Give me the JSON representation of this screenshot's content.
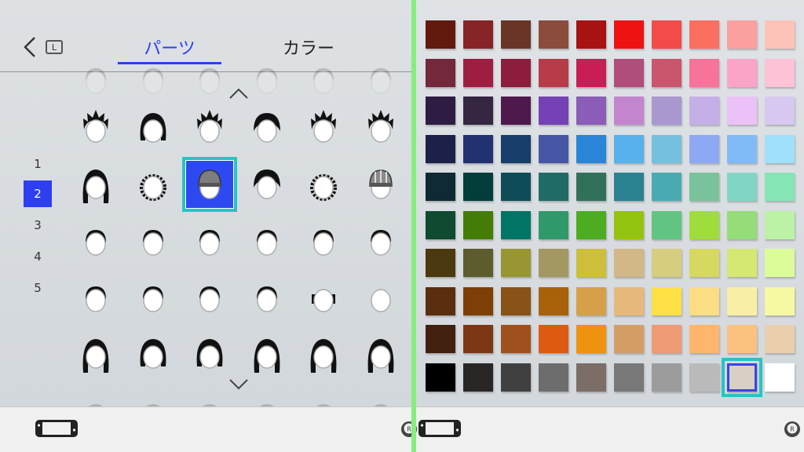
{
  "header": {
    "l_key_label": "L",
    "tabs": [
      {
        "label": "パーツ",
        "active": true
      },
      {
        "label": "カラー",
        "active": false
      }
    ]
  },
  "pages": {
    "items": [
      "1",
      "2",
      "3",
      "4",
      "5"
    ],
    "selected": "2"
  },
  "hair_grid": {
    "rows": [
      [
        "hair-spiky-short",
        "hair-bob-short",
        "hair-spiky-top",
        "hair-bowl",
        "hair-spiky-wide",
        "hair-spiky-messy"
      ],
      [
        "hair-long-wavy",
        "hair-curly-short",
        "hair-beanie-gray",
        "hair-mushroom",
        "hair-curly-fringe",
        "hair-beanie-striped"
      ],
      [
        "hair-buzz-1",
        "hair-buzz-2",
        "hair-buzz-3",
        "hair-buzz-4",
        "hair-buzz-5",
        "hair-buzz-6"
      ],
      [
        "hair-buzz-7",
        "hair-buzz-8",
        "hair-buzz-9",
        "hair-buzz-10",
        "hair-sides-only",
        "hair-bald"
      ],
      [
        "hair-bob-long",
        "hair-pigtails",
        "hair-bob-round",
        "hair-long-straight",
        "hair-long-layered",
        "hair-long-bangs"
      ]
    ],
    "selected": "hair-beanie-gray"
  },
  "colors": {
    "accent": "#2d3ff0",
    "selection_ring": "#28c3c6",
    "divider": "#86ee7d",
    "rows": [
      [
        "#621a0e",
        "#872427",
        "#693527",
        "#8b4c3e",
        "#a71212",
        "#ee1212",
        "#f34a4a",
        "#fb6f60",
        "#fc9f9f",
        "#fdc2b7"
      ],
      [
        "#73283b",
        "#9e1e42",
        "#8d1d3d",
        "#b73c49",
        "#c91e55",
        "#b04d7b",
        "#c9566c",
        "#f87399",
        "#fca3c8",
        "#fdc2d6"
      ],
      [
        "#2f1c43",
        "#352641",
        "#4e1a4d",
        "#7542b5",
        "#8b5cb8",
        "#c385cd",
        "#a997d0",
        "#c4b0e7",
        "#ecc1f7",
        "#d6c8f0"
      ],
      [
        "#1b2149",
        "#233172",
        "#173d6a",
        "#4656a4",
        "#2a84d8",
        "#56b1ec",
        "#75c1dd",
        "#8da9f3",
        "#80bbf8",
        "#9fe0fc"
      ],
      [
        "#102a34",
        "#033d3c",
        "#0f4c58",
        "#216b66",
        "#327159",
        "#2a8290",
        "#49abb1",
        "#7ac29b",
        "#80d6c3",
        "#86e5b4"
      ],
      [
        "#0f4a31",
        "#447d05",
        "#007465",
        "#30996a",
        "#4dac20",
        "#94c30e",
        "#62c481",
        "#9fdd3d",
        "#94dd78",
        "#bcf2a5"
      ],
      [
        "#4b3a10",
        "#5d5c2d",
        "#979633",
        "#a39862",
        "#cdbf3c",
        "#d1b886",
        "#d6cd7f",
        "#d7d860",
        "#d4e872",
        "#dcfc99"
      ],
      [
        "#5b2e0f",
        "#7d3f05",
        "#895217",
        "#a7620a",
        "#d5a049",
        "#e7b87b",
        "#fde044",
        "#fbdd83",
        "#f9eea6",
        "#f7f8a4"
      ],
      [
        "#41200f",
        "#7d3712",
        "#a0501e",
        "#dd5a10",
        "#ee9210",
        "#d59d66",
        "#ee9a74",
        "#fdb66b",
        "#fcc180",
        "#eacfad"
      ],
      [
        "#000000",
        "#2b2626",
        "#404040",
        "#6d6d6d",
        "#7a6e66",
        "#787878",
        "#9c9c9c",
        "#bababa",
        "#d8d0c4",
        "#ffffff"
      ]
    ],
    "selected_index": [
      9,
      8
    ]
  }
}
